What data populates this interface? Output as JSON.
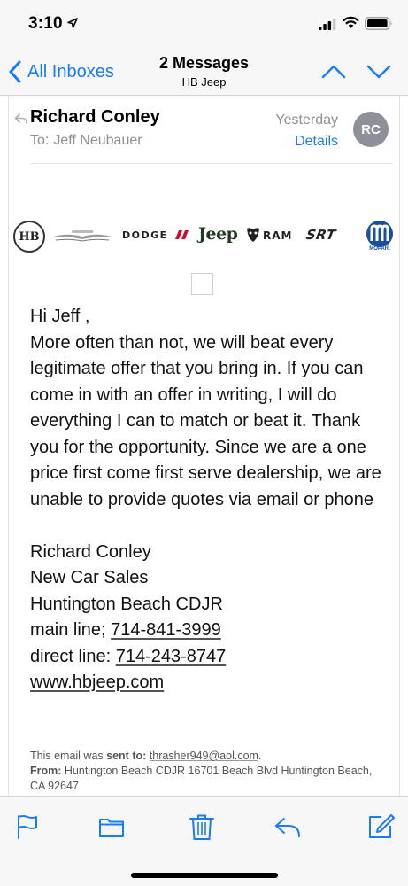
{
  "status_bar": {
    "time": "3:10"
  },
  "nav": {
    "back_label": "All Inboxes",
    "title": "2 Messages",
    "subtitle": "HB Jeep"
  },
  "message": {
    "sender": "Richard Conley",
    "to_label": "To:",
    "to_name": "Jeff Neubauer",
    "date": "Yesterday",
    "details_label": "Details",
    "avatar_initials": "RC"
  },
  "logos": {
    "hb": "HB",
    "dodge": "DODGE",
    "jeep": "Jeep",
    "ram": "RAM",
    "srt": "SRT",
    "mopar": "MOPAR."
  },
  "body": {
    "greeting": "Hi  Jeff ,",
    "paragraph": "More often than not, we will beat every legitimate offer that you bring in. If you can come in with an offer in writing, I will do everything I can to match or beat it. Thank you for the opportunity. Since we are a one price first come first serve dealership, we are unable to provide quotes via email or phone",
    "sig_name": "Richard Conley",
    "sig_title": "New Car Sales",
    "sig_company": "Huntington Beach CDJR",
    "main_line_label": "main line; ",
    "main_line_number": "714-841-3999",
    "direct_line_label": "direct line: ",
    "direct_line_number": "714-243-8747",
    "website": "www.hbjeep.com"
  },
  "footer": {
    "sent_prefix": "This email was ",
    "sent_bold": "sent to:",
    "sent_email": "thrasher949@aol.com",
    "sent_suffix": ".",
    "from_label": "From:",
    "from_text": "Huntington Beach CDJR 16701 Beach Blvd Huntington Beach, CA 92647"
  },
  "toolbar": {
    "icons": [
      "flag-icon",
      "folder-icon",
      "trash-icon",
      "reply-icon",
      "compose-icon"
    ]
  },
  "colors": {
    "accent": "#1a7cf5",
    "secondary_text": "#8e8e93",
    "avatar_bg": "#8e9099",
    "bar_bg": "#f7f7f7"
  }
}
